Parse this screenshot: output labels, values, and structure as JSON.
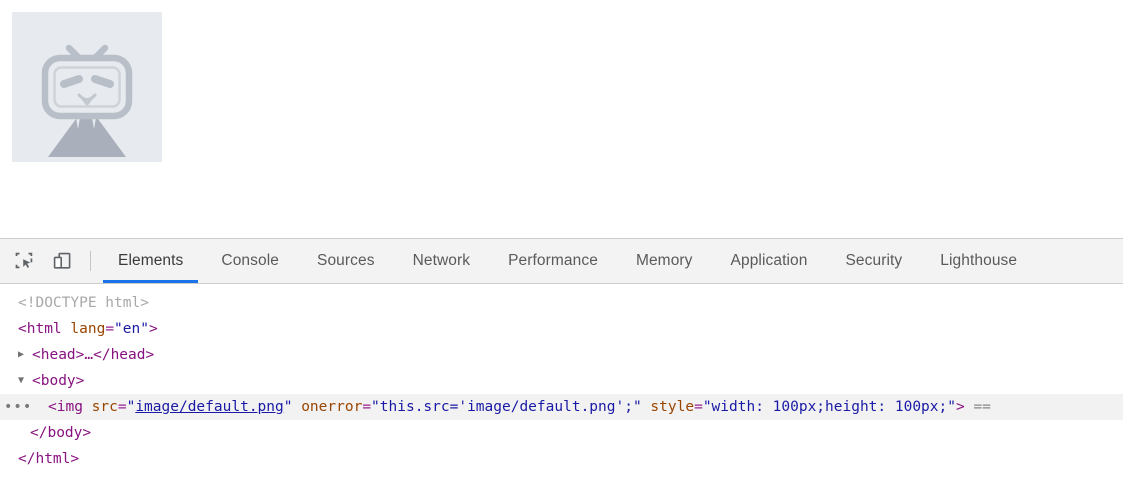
{
  "viewport": {
    "image": {
      "alt_state": "broken-image-placeholder",
      "description": "TV mascot placeholder",
      "bg_color": "#e7eaee",
      "fg_color": "#a9b0bb"
    }
  },
  "devtools": {
    "toolbar": {
      "inspect_icon": "inspect-element-icon",
      "device_icon": "device-toolbar-icon"
    },
    "tabs": [
      {
        "label": "Elements",
        "active": true
      },
      {
        "label": "Console",
        "active": false
      },
      {
        "label": "Sources",
        "active": false
      },
      {
        "label": "Network",
        "active": false
      },
      {
        "label": "Performance",
        "active": false
      },
      {
        "label": "Memory",
        "active": false
      },
      {
        "label": "Application",
        "active": false
      },
      {
        "label": "Security",
        "active": false
      },
      {
        "label": "Lighthouse",
        "active": false
      }
    ],
    "active_tab_accent": "#1a73e8",
    "dom": {
      "doctype": "<!DOCTYPE html>",
      "html_open_tag": "<html",
      "html_attr_name": "lang",
      "html_attr_eq": "=",
      "html_attr_value": "\"en\"",
      "html_open_close": ">",
      "head_line": "<head>…</head>",
      "body_open": "<body>",
      "img": {
        "ellipsis": "•••",
        "open": "<img",
        "attr_src": "src",
        "src_value": "image/default.png",
        "attr_onerror": "onerror",
        "onerror_value": "this.src='image/default.png';",
        "attr_style": "style",
        "style_value": "width: 100px;height: 100px;",
        "close": ">",
        "selection_marker": "=="
      },
      "body_close": "</body>",
      "html_close": "</html>"
    }
  }
}
